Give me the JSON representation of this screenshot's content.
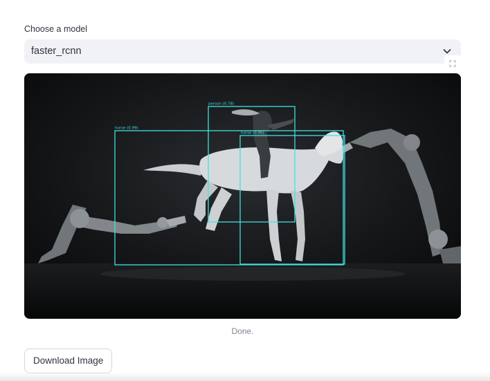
{
  "model_select": {
    "label": "Choose a model",
    "selected_value": "faster_rcnn"
  },
  "image": {
    "detections": [
      {
        "label": "person (0.78)"
      },
      {
        "label": "horse (0.99)"
      },
      {
        "label": "horse (0.90)"
      }
    ],
    "box_color": "#40e0e0",
    "caption": "Done."
  },
  "download_button": {
    "label": "Download Image"
  },
  "icons": {
    "chevron": "chevron-down-icon",
    "fullscreen": "fullscreen-icon"
  }
}
